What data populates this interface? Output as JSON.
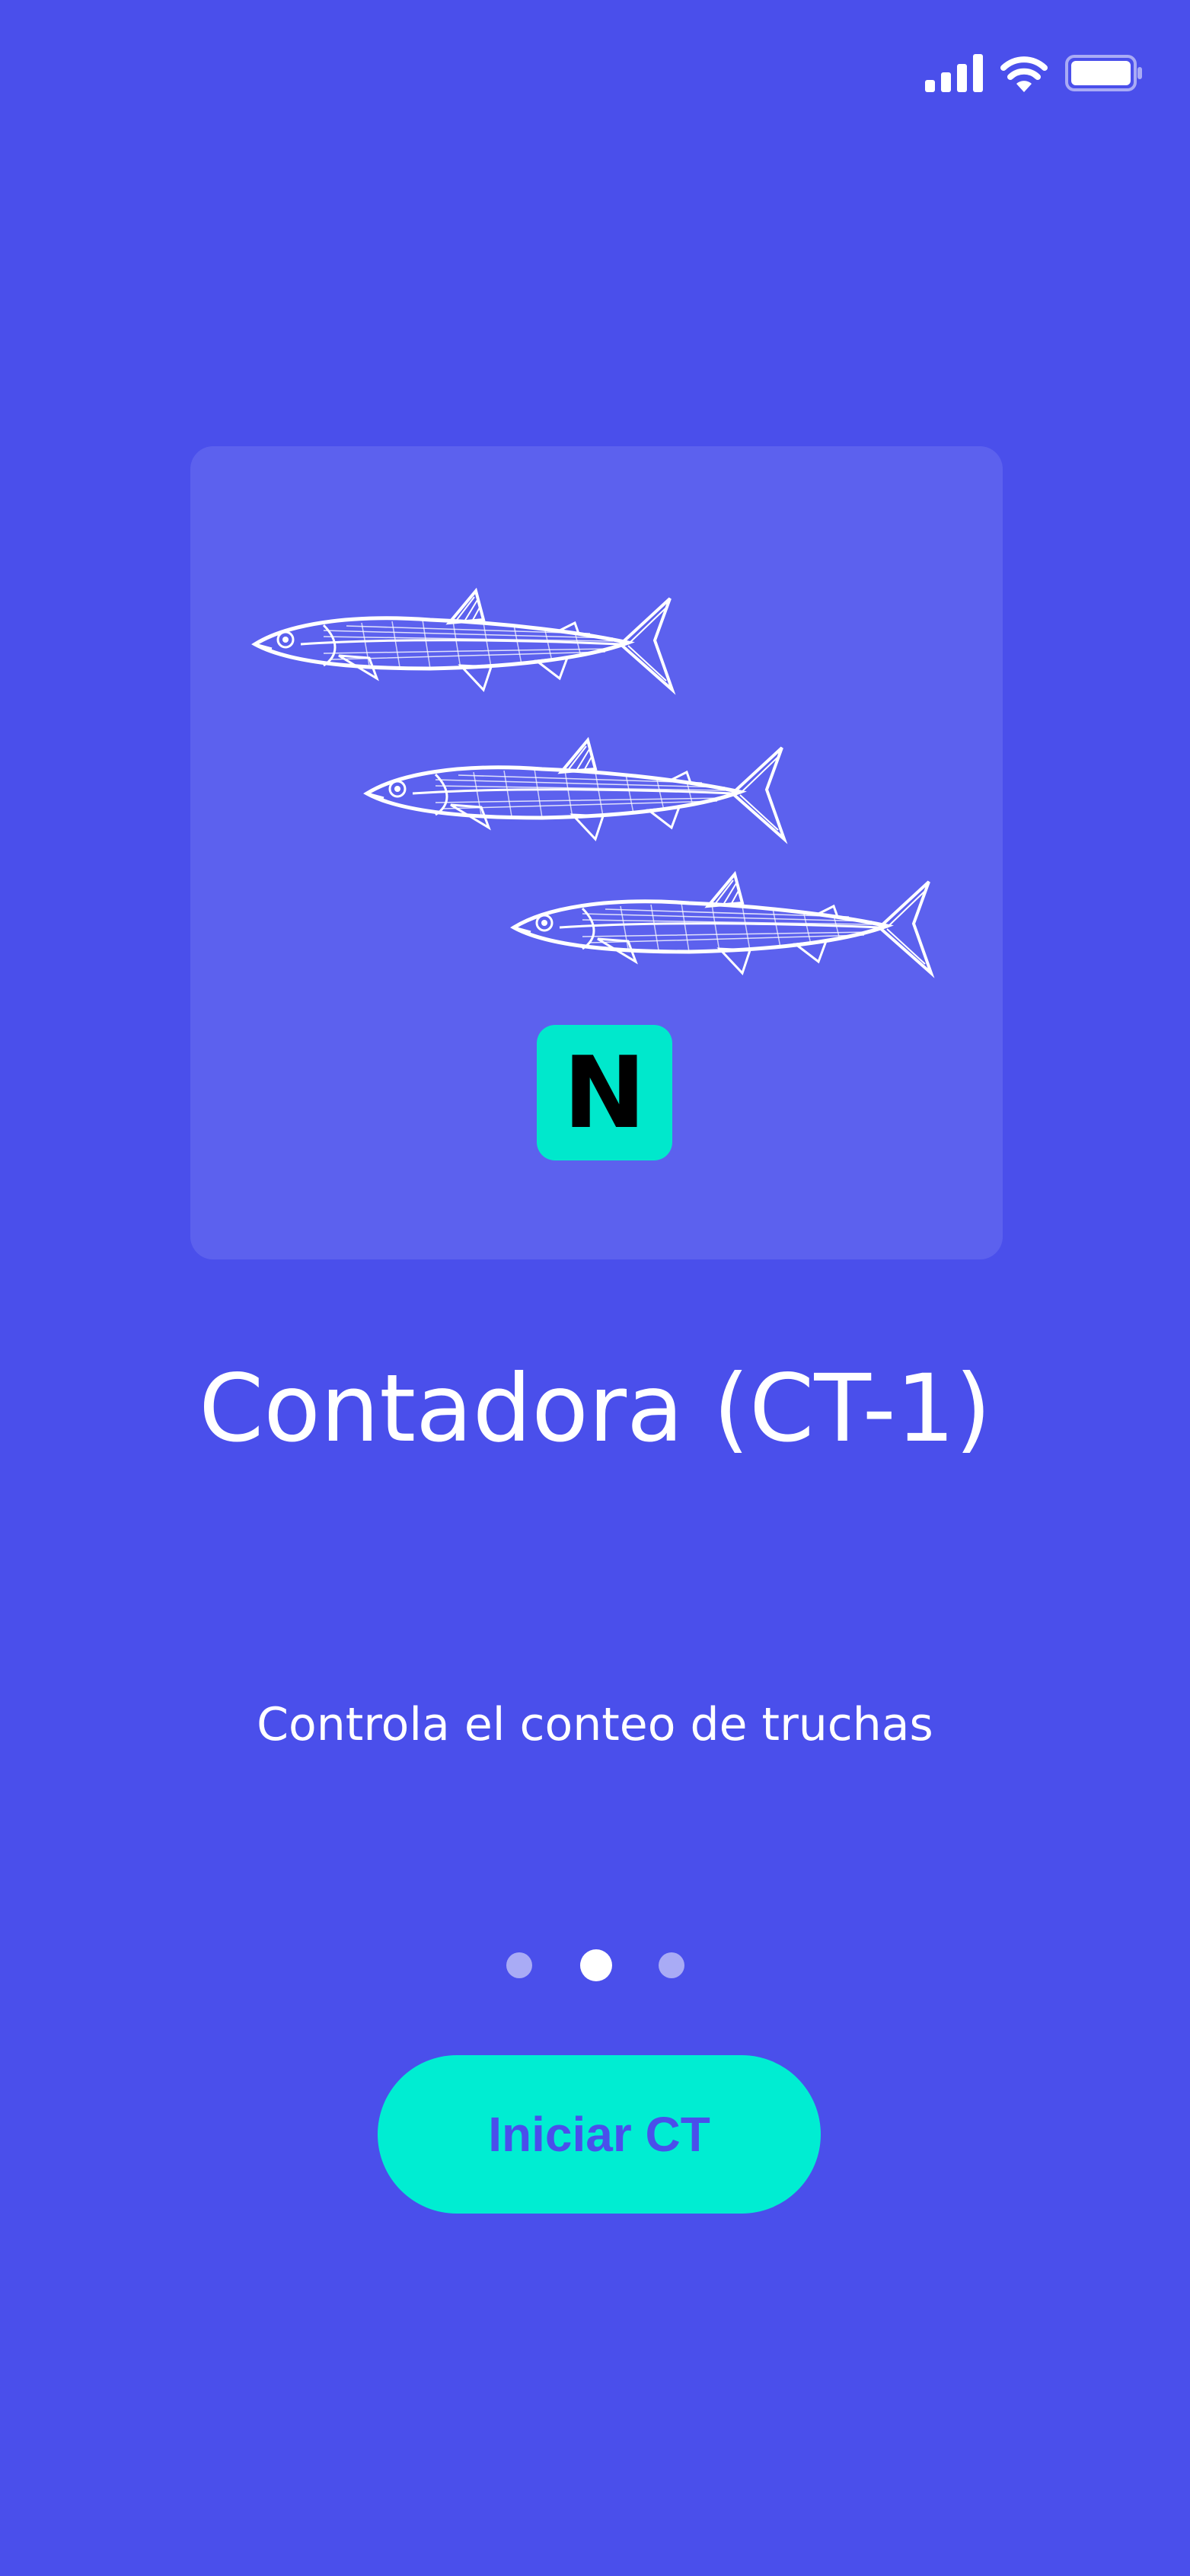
{
  "status_bar": {
    "icons": [
      "cellular-signal-icon",
      "wifi-icon",
      "battery-icon"
    ]
  },
  "hero": {
    "illustration": "trout-fish-illustration",
    "badge_letter": "N"
  },
  "title": "Contadora (CT-1)",
  "subtitle": "Controla el conteo de truchas",
  "pagination": {
    "total": 3,
    "active_index": 1
  },
  "cta": {
    "label": "Iniciar CT"
  },
  "colors": {
    "background": "#4A4FEB",
    "card": "#5C61EE",
    "accent": "#00EDD2",
    "dot_inactive": "#A9ABF5",
    "dot_active": "#FFFFFF"
  }
}
